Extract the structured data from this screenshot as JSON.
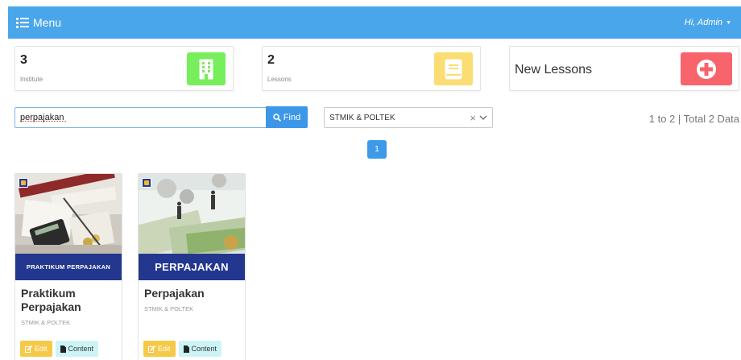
{
  "navbar": {
    "menu_label": "Menu",
    "user_label": "Hi, Admin"
  },
  "stats": [
    {
      "number": "3",
      "label": "Institute",
      "icon": "building-icon",
      "color": "#77ee5c"
    },
    {
      "number": "2",
      "label": "Lessons",
      "icon": "book-icon",
      "color": "#fbdd73"
    },
    {
      "title": "New Lessons",
      "icon": "plus-circle-icon",
      "color": "#f7646c"
    }
  ],
  "search": {
    "value": "perpajakan",
    "button_label": "Find",
    "button_icon": "search-icon"
  },
  "filter": {
    "selected": "STMIK & POLTEK"
  },
  "paging": {
    "info": "1 to 2 | Total 2 Data",
    "pages": [
      "1"
    ]
  },
  "courses": [
    {
      "title": "Praktikum Perpajakan",
      "institute": "STMIK & POLTEK",
      "banner": "PRAKTIKUM PERPAJAKAN",
      "edit_label": "Edit",
      "content_label": "Content"
    },
    {
      "title": "Perpajakan",
      "institute": "STMIK & POLTEK",
      "banner": "PERPAJAKAN",
      "edit_label": "Edit",
      "content_label": "Content"
    }
  ],
  "colors": {
    "navbar": "#4aa6ea",
    "primary_button": "#3d97e8",
    "edit_button": "#f7c948",
    "content_button": "#ccf4f6",
    "banner": "#23378f"
  }
}
